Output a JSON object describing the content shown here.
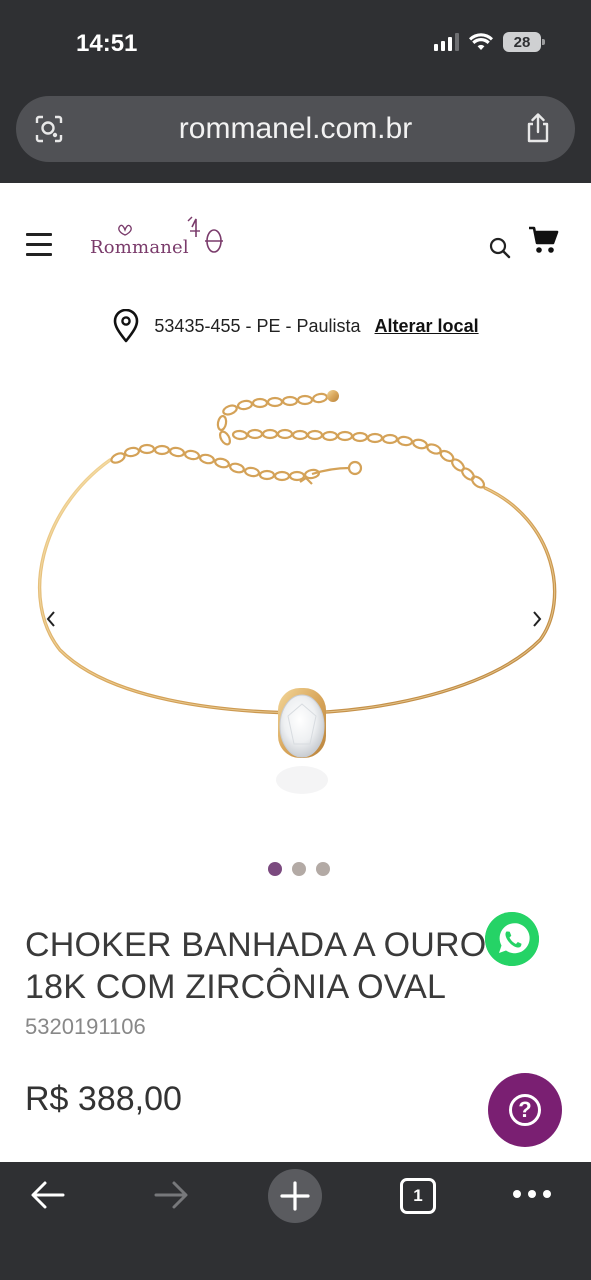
{
  "status_bar": {
    "time": "14:51",
    "battery": "28",
    "icons": [
      "signal-icon",
      "wifi-icon",
      "battery-icon"
    ]
  },
  "browser": {
    "url": "rommanel.com.br",
    "tab_count": "1",
    "icons": [
      "lens-icon",
      "share-icon",
      "back-icon",
      "forward-icon",
      "new-tab-icon",
      "tabs-icon",
      "more-icon"
    ]
  },
  "header": {
    "logo_text": "Rommanel",
    "icons": [
      "menu-icon",
      "search-icon",
      "cart-icon"
    ]
  },
  "location": {
    "text": "53435-455 - PE - Paulista",
    "link": "Alterar local"
  },
  "carousel": {
    "slide_count": 3,
    "active_index": 0
  },
  "product": {
    "title": "CHOKER BANHADA A OURO 18K COM ZIRCÔNIA OVAL",
    "sku": "5320191106",
    "price": "R$ 388,00"
  },
  "floating": {
    "help_glyph": "?",
    "icons": [
      "whatsapp-icon",
      "help-icon"
    ]
  },
  "colors": {
    "brand": "#7a1f72",
    "dot_active": "#7b4a7f",
    "whatsapp": "#25d366"
  }
}
